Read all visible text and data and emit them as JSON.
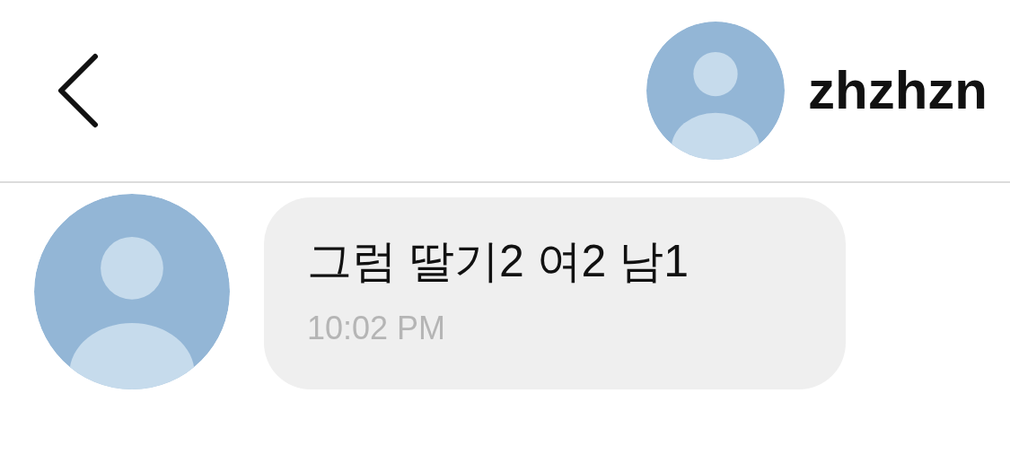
{
  "header": {
    "username": "zhzhzn"
  },
  "messages": [
    {
      "text": "그럼 딸기2 여2 남1",
      "time": "10:02 PM"
    }
  ]
}
